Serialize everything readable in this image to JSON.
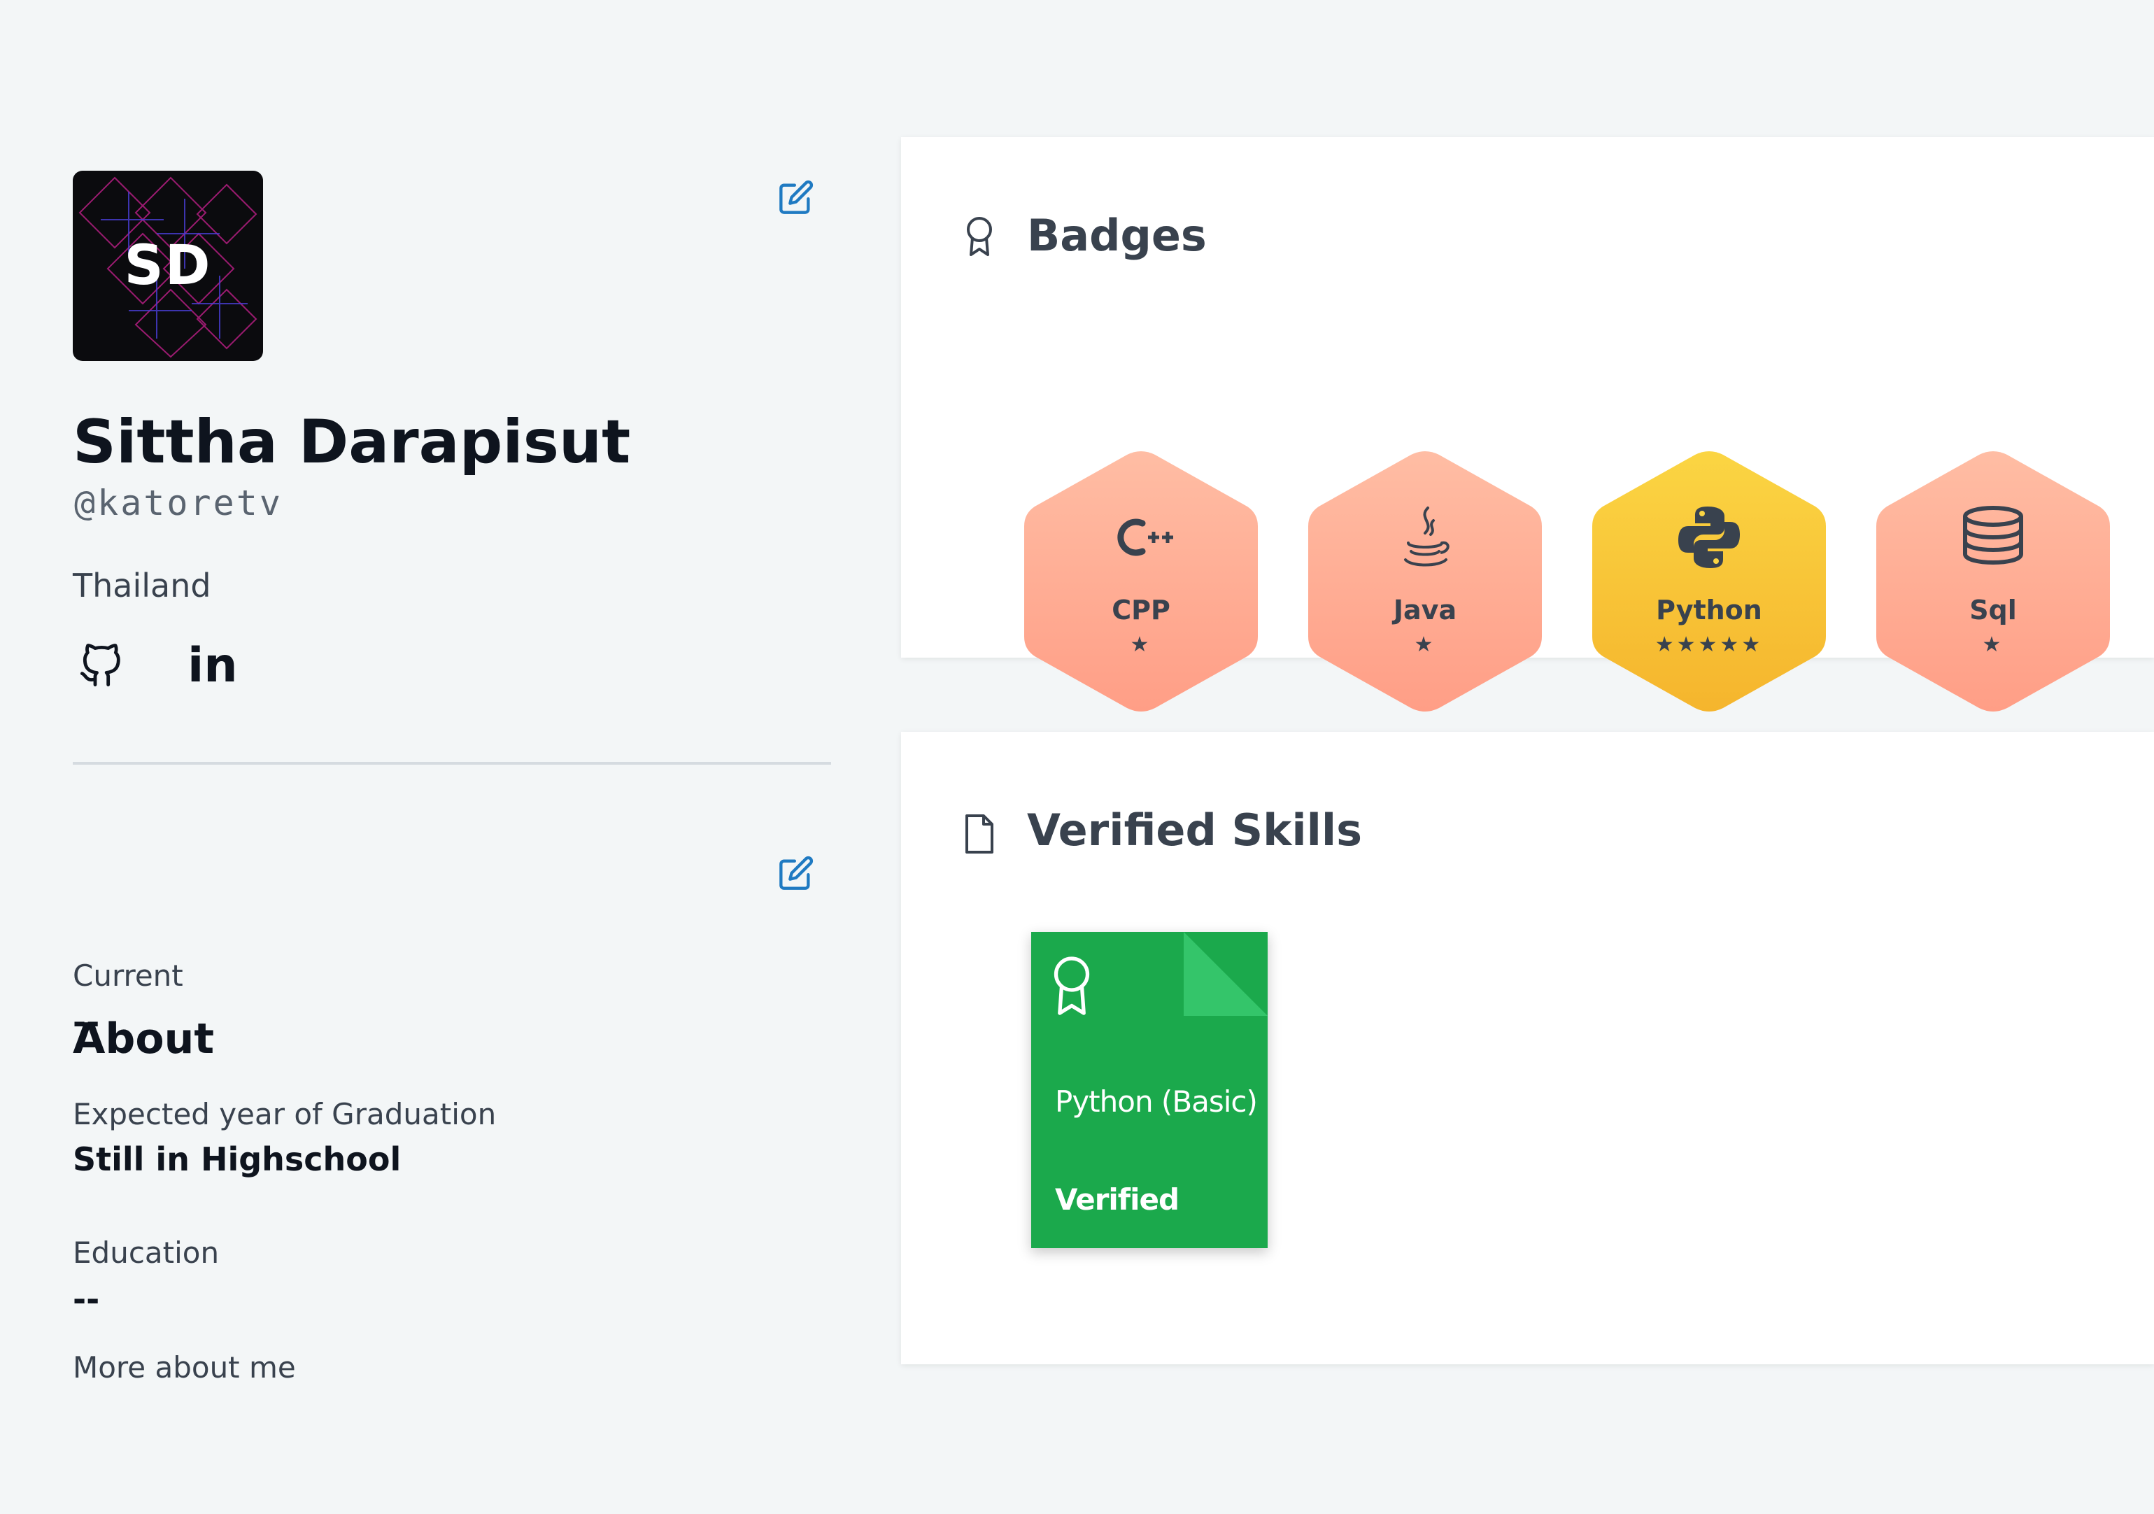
{
  "profile": {
    "avatar_initials": "SD",
    "name": "Sittha Darapisut",
    "handle": "@katoretv",
    "country": "Thailand",
    "social": {
      "linkedin_label": "in"
    }
  },
  "about": {
    "title": "About",
    "fields": [
      {
        "label": "Current",
        "value": "--"
      },
      {
        "label": "Expected year of Graduation",
        "value": "Still in Highschool"
      },
      {
        "label": "Education",
        "value": "--"
      }
    ],
    "more_label": "More about me"
  },
  "badges_section": {
    "title": "Badges",
    "items": [
      {
        "name": "CPP",
        "icon": "cpp-icon",
        "stars": 1,
        "star_glyphs": "★",
        "color_top": "#ffbda4",
        "color_bottom": "#ff9e86"
      },
      {
        "name": "Java",
        "icon": "java-icon",
        "stars": 1,
        "star_glyphs": "★",
        "color_top": "#ffbda4",
        "color_bottom": "#ff9e86"
      },
      {
        "name": "Python",
        "icon": "python-icon",
        "stars": 5,
        "star_glyphs": "★★★★★",
        "color_top": "#fbd543",
        "color_bottom": "#f5b52d"
      },
      {
        "name": "Sql",
        "icon": "sql-icon",
        "stars": 1,
        "star_glyphs": "★",
        "color_top": "#ffbda4",
        "color_bottom": "#ff9e86"
      }
    ]
  },
  "skills_section": {
    "title": "Verified Skills",
    "items": [
      {
        "name": "Python (Basic)",
        "status": "Verified",
        "color": "#1ba94c"
      }
    ]
  },
  "colors": {
    "accent": "#1f7ac2",
    "background": "#f3f6f7",
    "text_dark": "#0e141e",
    "text_muted": "#39424e"
  }
}
